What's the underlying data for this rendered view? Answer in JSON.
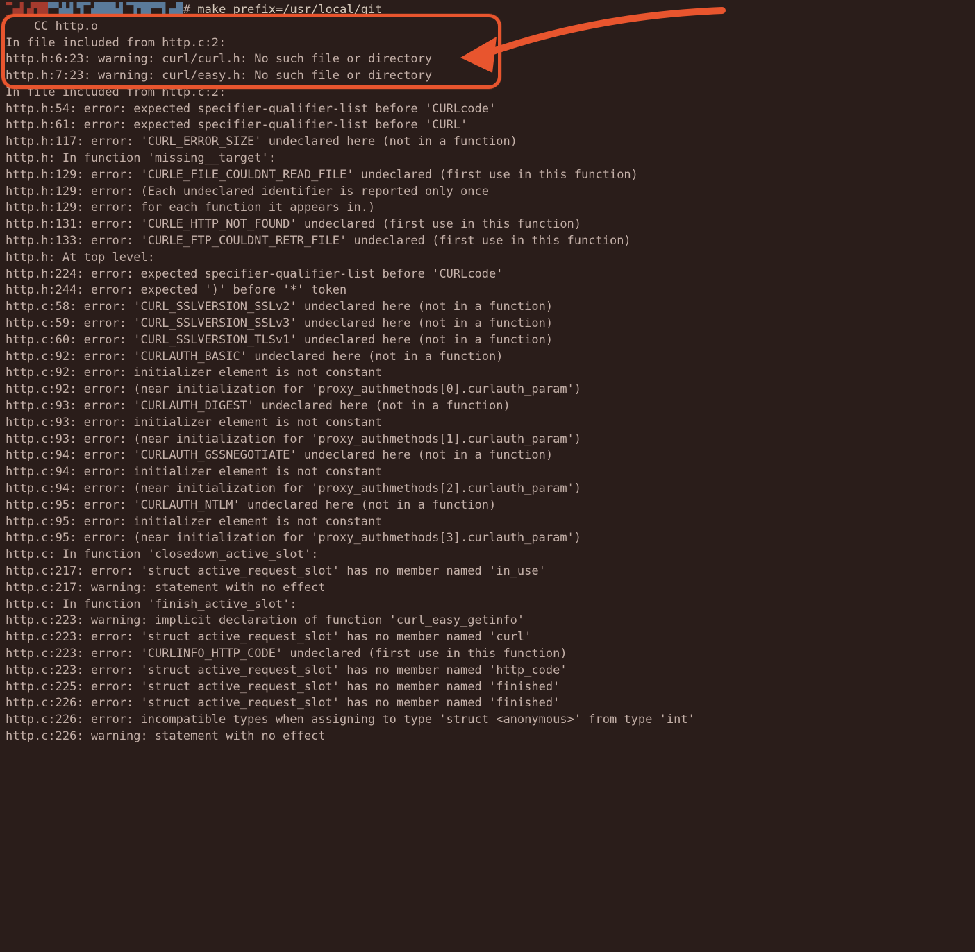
{
  "prompt": {
    "hash_char": "#",
    "command": "make prefix=/usr/local/git"
  },
  "lines": [
    "    CC http.o",
    "In file included from http.c:2:",
    "http.h:6:23: warning: curl/curl.h: No such file or directory",
    "http.h:7:23: warning: curl/easy.h: No such file or directory",
    "In file included from http.c:2:",
    "http.h:54: error: expected specifier-qualifier-list before 'CURLcode'",
    "http.h:61: error: expected specifier-qualifier-list before 'CURL'",
    "http.h:117: error: 'CURL_ERROR_SIZE' undeclared here (not in a function)",
    "http.h: In function 'missing__target':",
    "http.h:129: error: 'CURLE_FILE_COULDNT_READ_FILE' undeclared (first use in this function)",
    "http.h:129: error: (Each undeclared identifier is reported only once",
    "http.h:129: error: for each function it appears in.)",
    "http.h:131: error: 'CURLE_HTTP_NOT_FOUND' undeclared (first use in this function)",
    "http.h:133: error: 'CURLE_FTP_COULDNT_RETR_FILE' undeclared (first use in this function)",
    "http.h: At top level:",
    "http.h:224: error: expected specifier-qualifier-list before 'CURLcode'",
    "http.h:244: error: expected ')' before '*' token",
    "http.c:58: error: 'CURL_SSLVERSION_SSLv2' undeclared here (not in a function)",
    "http.c:59: error: 'CURL_SSLVERSION_SSLv3' undeclared here (not in a function)",
    "http.c:60: error: 'CURL_SSLVERSION_TLSv1' undeclared here (not in a function)",
    "http.c:92: error: 'CURLAUTH_BASIC' undeclared here (not in a function)",
    "http.c:92: error: initializer element is not constant",
    "http.c:92: error: (near initialization for 'proxy_authmethods[0].curlauth_param')",
    "http.c:93: error: 'CURLAUTH_DIGEST' undeclared here (not in a function)",
    "http.c:93: error: initializer element is not constant",
    "http.c:93: error: (near initialization for 'proxy_authmethods[1].curlauth_param')",
    "http.c:94: error: 'CURLAUTH_GSSNEGOTIATE' undeclared here (not in a function)",
    "http.c:94: error: initializer element is not constant",
    "http.c:94: error: (near initialization for 'proxy_authmethods[2].curlauth_param')",
    "http.c:95: error: 'CURLAUTH_NTLM' undeclared here (not in a function)",
    "http.c:95: error: initializer element is not constant",
    "http.c:95: error: (near initialization for 'proxy_authmethods[3].curlauth_param')",
    "http.c: In function 'closedown_active_slot':",
    "http.c:217: error: 'struct active_request_slot' has no member named 'in_use'",
    "http.c:217: warning: statement with no effect",
    "http.c: In function 'finish_active_slot':",
    "http.c:223: warning: implicit declaration of function 'curl_easy_getinfo'",
    "http.c:223: error: 'struct active_request_slot' has no member named 'curl'",
    "http.c:223: error: 'CURLINFO_HTTP_CODE' undeclared (first use in this function)",
    "http.c:223: error: 'struct active_request_slot' has no member named 'http_code'",
    "http.c:225: error: 'struct active_request_slot' has no member named 'finished'",
    "http.c:226: error: 'struct active_request_slot' has no member named 'finished'",
    "http.c:226: error: incompatible types when assigning to type 'struct <anonymous>' from type 'int'",
    "http.c:226: warning: statement with no effect"
  ],
  "annotation": {
    "highlight_color": "#e8552e"
  }
}
